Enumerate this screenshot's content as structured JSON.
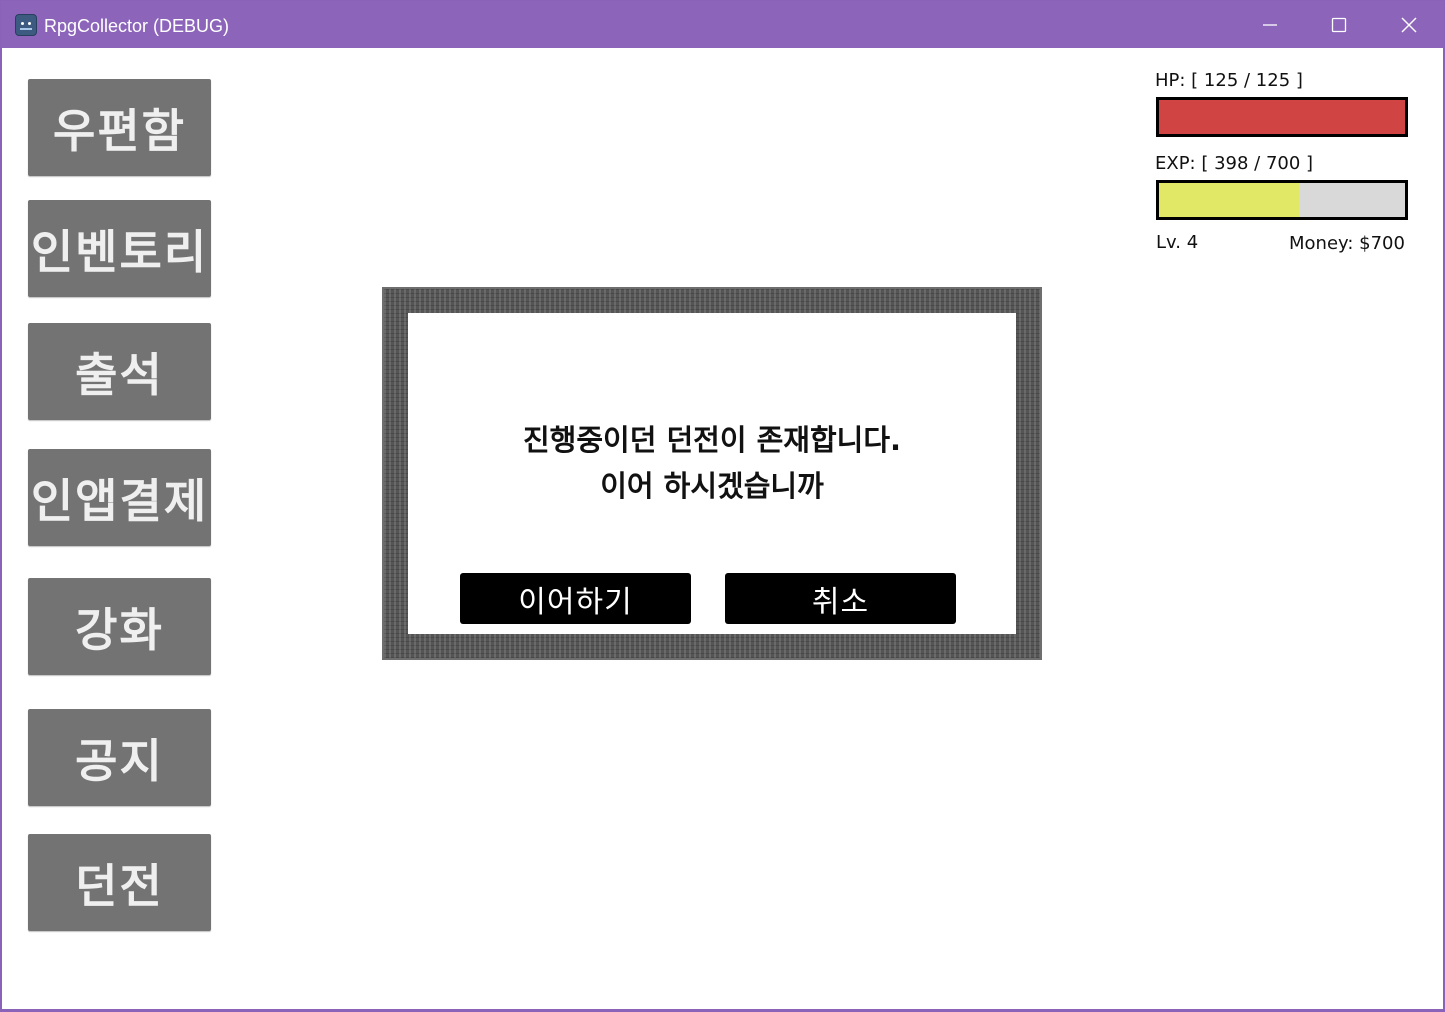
{
  "window": {
    "title": "RpgCollector (DEBUG)",
    "minimize_icon": "minimize-icon",
    "maximize_icon": "maximize-icon",
    "close_icon": "close-icon",
    "accent": "#8c65bb"
  },
  "menu": {
    "items": [
      {
        "label": "우편함"
      },
      {
        "label": "인벤토리"
      },
      {
        "label": "출석"
      },
      {
        "label": "인앱결제"
      },
      {
        "label": "강화"
      },
      {
        "label": "공지"
      },
      {
        "label": "던전"
      }
    ],
    "button_color": "#737373"
  },
  "stats": {
    "hp_label": "HP: [ 125 / 125 ]",
    "hp": {
      "current": 125,
      "max": 125,
      "color": "#d04444"
    },
    "exp_label": "EXP: [ 398 / 700 ]",
    "exp": {
      "current": 398,
      "max": 700,
      "color": "#e0e866"
    },
    "level_label": "Lv. 4",
    "money_label": "Money: $700"
  },
  "dialog": {
    "message_line1": "진행중이던 던전이 존재합니다.",
    "message_line2": "이어 하시겠습니까",
    "continue_label": "이어하기",
    "cancel_label": "취소"
  }
}
